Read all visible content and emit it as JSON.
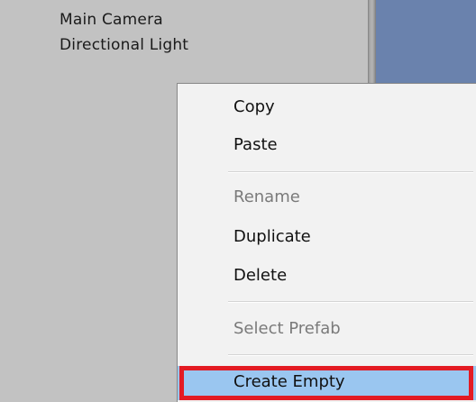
{
  "hierarchy": {
    "items": [
      {
        "label": "Main Camera"
      },
      {
        "label": "Directional Light"
      }
    ]
  },
  "context_menu": {
    "items": [
      {
        "label": "Copy",
        "enabled": true
      },
      {
        "label": "Paste",
        "enabled": true
      },
      {
        "label": "Rename",
        "enabled": false
      },
      {
        "label": "Duplicate",
        "enabled": true
      },
      {
        "label": "Delete",
        "enabled": true
      },
      {
        "label": "Select Prefab",
        "enabled": false
      },
      {
        "label": "Create Empty",
        "enabled": true,
        "highlighted": true
      }
    ]
  },
  "colors": {
    "panel_background": "#c2c2c2",
    "scene_view": "#6a82ad",
    "menu_background": "#f2f2f2",
    "menu_hover": "#9ac6f0",
    "highlight_outline": "#e31b23",
    "disabled_text": "#7a7a7a"
  }
}
